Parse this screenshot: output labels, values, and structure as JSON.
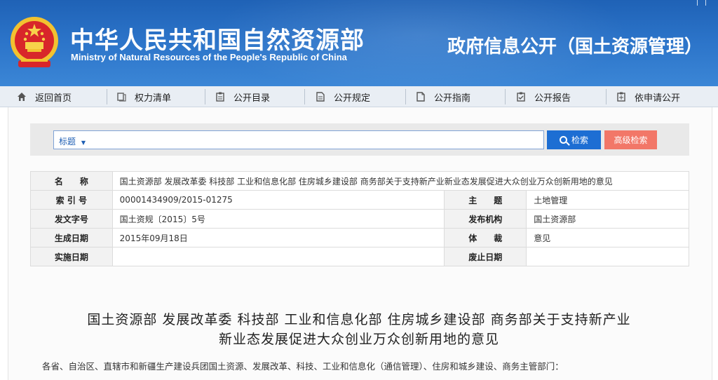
{
  "header": {
    "topbar": [
      "| ",
      "| ",
      ""
    ],
    "ministry_cn": "中华人民共和国自然资源部",
    "ministry_en": "Ministry of Natural Resources of the People's Republic of China",
    "portal_title": "政府信息公开（国土资源管理）",
    "colors": {
      "header_blue": "#2b73c8",
      "search_blue": "#1d6ed3",
      "adv_red": "#f27768"
    }
  },
  "nav": {
    "items": [
      {
        "label": "返回首页",
        "icon": "home-icon"
      },
      {
        "label": "权力清单",
        "icon": "list-icon"
      },
      {
        "label": "公开目录",
        "icon": "catalog-icon"
      },
      {
        "label": "公开规定",
        "icon": "document-icon"
      },
      {
        "label": "公开指南",
        "icon": "guide-icon"
      },
      {
        "label": "公开报告",
        "icon": "report-icon"
      },
      {
        "label": "依申请公开",
        "icon": "application-icon"
      }
    ]
  },
  "search": {
    "field_select": "标题",
    "search_button": "检索",
    "advanced_button": "高级检索"
  },
  "info": {
    "name_label": "名　　称",
    "name_value": "国土资源部 发展改革委 科技部 工业和信息化部 住房城乡建设部 商务部关于支持新产业新业态发展促进大众创业万众创新用地的意见",
    "index_label": "索 引 号",
    "index_value": "00001434909/2015-01275",
    "topic_label": "主　　题",
    "topic_value": "土地管理",
    "docno_label": "发文字号",
    "docno_value": "国土资规〔2015〕5号",
    "issuer_label": "发布机构",
    "issuer_value": "国土资源部",
    "created_label": "生成日期",
    "created_value": "2015年09月18日",
    "genre_label": "体　　裁",
    "genre_value": "意见",
    "effective_label": "实施日期",
    "effective_value": "",
    "abolish_label": "废止日期",
    "abolish_value": ""
  },
  "article": {
    "title_line1": "国土资源部 发展改革委 科技部 工业和信息化部 住房城乡建设部 商务部关于支持新产业",
    "title_line2": "新业态发展促进大众创业万众创新用地的意见",
    "body_first_line": "各省、自治区、直辖市和新疆生产建设兵团国土资源、发展改革、科技、工业和信息化（通信管理）、住房和城乡建设、商务主管部门："
  }
}
